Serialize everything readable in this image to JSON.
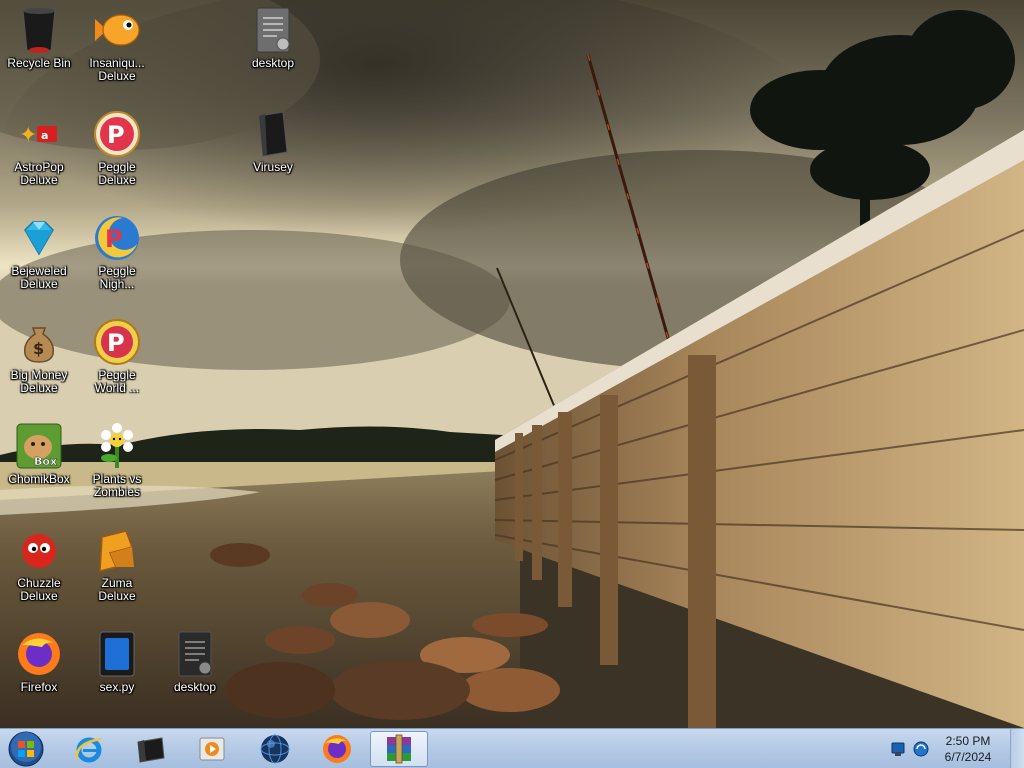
{
  "desktop_icons": [
    {
      "id": "recycle-bin",
      "label": "Recycle Bin",
      "icon": "recycle-bin-icon"
    },
    {
      "id": "insaniquarium",
      "label": "Insaniqu...\nDeluxe",
      "icon": "goldfish-icon"
    },
    {
      "id": "desktop-file-1",
      "label": "desktop",
      "icon": "document-icon"
    },
    {
      "id": "astropop",
      "label": "AstroPop\nDeluxe",
      "icon": "astropop-icon"
    },
    {
      "id": "peggle-deluxe",
      "label": "Peggle\nDeluxe",
      "icon": "peggle-icon"
    },
    {
      "id": "virusey",
      "label": "Virusey",
      "icon": "black-file-icon"
    },
    {
      "id": "bejeweled",
      "label": "Bejeweled\nDeluxe",
      "icon": "diamond-icon"
    },
    {
      "id": "peggle-nights",
      "label": "Peggle\nNigh...",
      "icon": "peggle-nights-icon"
    },
    {
      "id": "big-money",
      "label": "Big Money\nDeluxe",
      "icon": "money-bag-icon"
    },
    {
      "id": "peggle-world",
      "label": "Peggle\nWorld ...",
      "icon": "peggle-world-icon"
    },
    {
      "id": "chomikbox",
      "label": "ChomikBox",
      "icon": "hamster-icon"
    },
    {
      "id": "pvz",
      "label": "Plants vs\nZombies",
      "icon": "flower-icon"
    },
    {
      "id": "chuzzle",
      "label": "Chuzzle\nDeluxe",
      "icon": "chuzzle-icon"
    },
    {
      "id": "zuma",
      "label": "Zuma\nDeluxe",
      "icon": "zuma-icon"
    },
    {
      "id": "firefox-desktop",
      "label": "Firefox",
      "icon": "firefox-icon"
    },
    {
      "id": "sex-py",
      "label": "sex.py",
      "icon": "python-file-icon"
    },
    {
      "id": "desktop-file-2",
      "label": "desktop",
      "icon": "document-icon"
    }
  ],
  "taskbar": {
    "start_icon": "windows-logo-icon",
    "pinned": [
      {
        "id": "ie",
        "icon": "internet-explorer-icon"
      },
      {
        "id": "explorer",
        "icon": "folder-icon"
      },
      {
        "id": "media-player",
        "icon": "media-player-icon"
      },
      {
        "id": "globe",
        "icon": "globe-icon"
      },
      {
        "id": "firefox",
        "icon": "firefox-icon"
      },
      {
        "id": "winrar",
        "icon": "winrar-icon",
        "active": true
      }
    ],
    "tray": {
      "icons": [
        "network-icon",
        "sync-icon"
      ],
      "time": "2:50 PM",
      "date": "6/7/2024"
    }
  },
  "colors": {
    "taskbar": "#b5cbe6",
    "label_text": "#ffffff"
  }
}
